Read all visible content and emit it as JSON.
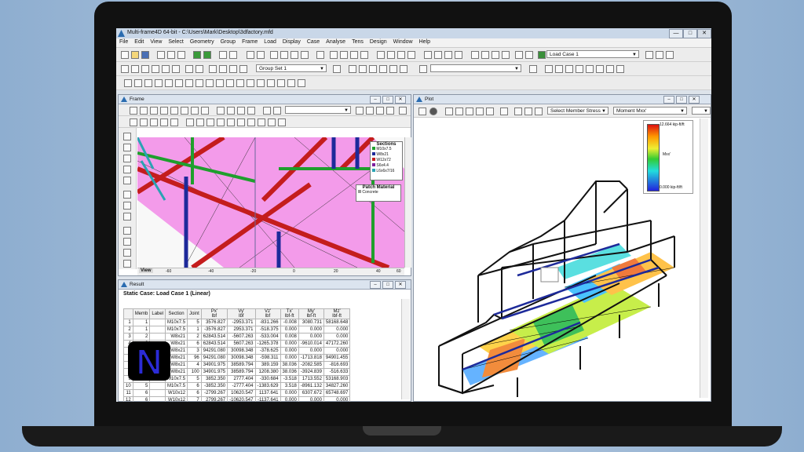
{
  "window": {
    "title": "Multi-frame4D 64-bit - C:\\Users\\Mark\\Desktop\\3dfactory.mfd",
    "btn_min": "—",
    "btn_max": "□",
    "btn_close": "✕"
  },
  "menu": [
    "File",
    "Edit",
    "View",
    "Select",
    "Geometry",
    "Group",
    "Frame",
    "Load",
    "Display",
    "Case",
    "Analyse",
    "Tens",
    "Design",
    "Window",
    "Help"
  ],
  "toolbar": {
    "load_case": "Load Case 1",
    "group_set": "Group Set 1"
  },
  "frame_panel": {
    "title": "Frame",
    "view_tab": "View",
    "ruler": [
      "-60",
      "-40",
      "-20",
      "0",
      "20",
      "40",
      "60"
    ],
    "legend_title": "Sections",
    "sections": [
      {
        "name": "M10x7.5",
        "color": "#1f9f2d"
      },
      {
        "name": "W8x21",
        "color": "#1d2a9a"
      },
      {
        "name": "W12x72",
        "color": "#c41d1d"
      },
      {
        "name": "S6x4.4",
        "color": "#7d1e9e"
      },
      {
        "name": "L6x6x7/16",
        "color": "#2aa3b3"
      }
    ],
    "patch_title": "Patch Material",
    "patch_item": "Concrete"
  },
  "plot_panel": {
    "title": "Plot",
    "select_stress": "Select Member Stress",
    "moment": "Moment Mxx'",
    "scale_max": "12.664 kip-ft/ft",
    "scale_label": "Mxx'",
    "scale_min": "0.000 kip-ft/ft"
  },
  "result_panel": {
    "title": "Result",
    "heading": "Static Case: Load Case 1 (Linear)",
    "cols": [
      "",
      "Memb",
      "Label",
      "Section",
      "Joint",
      "Px'\nlbf",
      "Vy'\nlbf",
      "Vz'\nlbf",
      "Tx'\nlbf-ft",
      "My'\nlbf-ft",
      "Mz'\nlbf-ft"
    ],
    "rows": [
      [
        "1",
        "1",
        "",
        "M10x7.5",
        "5",
        "3576.827",
        "-2953.371",
        "-831.266",
        "-0.008",
        "3080.731",
        "58168.648"
      ],
      [
        "2",
        "1",
        "",
        "M10x7.5",
        "1",
        "-3576.827",
        "2953.371",
        "-518.375",
        "0.000",
        "0.000",
        "0.000"
      ],
      [
        "3",
        "2",
        "",
        "W8x21",
        "2",
        "62843.514",
        "-5607.263",
        "-533.004",
        "0.008",
        "0.000",
        "0.000"
      ],
      [
        "4",
        "2",
        "",
        "W8x21",
        "6",
        "62843.514",
        "5607.263",
        "-1265.378",
        "0.000",
        "-9610.014",
        "47172.260"
      ],
      [
        "5",
        "3",
        "",
        "W8x21",
        "3",
        "94291.080",
        "30098.348",
        "-378.625",
        "0.000",
        "0.000",
        "0.000"
      ],
      [
        "6",
        "3",
        "",
        "W8x21",
        "96",
        "94291.080",
        "30098.348",
        "-598.311",
        "0.000",
        "-1713.818",
        "94901.455"
      ],
      [
        "7",
        "4",
        "",
        "W8x21",
        "4",
        "34901.975",
        "38589.794",
        "389.159",
        "38.036",
        "-2082.585",
        "-816.693"
      ],
      [
        "8",
        "4",
        "",
        "W8x21",
        "100",
        "34901.975",
        "38589.794",
        "1208.380",
        "38.036",
        "-3924.839",
        "-516.633"
      ],
      [
        "9",
        "5",
        "",
        "M10x7.5",
        "5",
        "3852.350",
        "2777.404",
        "-330.684",
        "-3.518",
        "1713.552",
        "53168.903"
      ],
      [
        "10",
        "5",
        "",
        "M10x7.5",
        "6",
        "-3852.350",
        "-2777.404",
        "-1383.629",
        "3.518",
        "-8961.132",
        "34827.260"
      ],
      [
        "11",
        "6",
        "",
        "W10x12",
        "6",
        "-2799.267",
        "10620.547",
        "1137.641",
        "0.000",
        "6307.672",
        "65748.697"
      ],
      [
        "12",
        "6",
        "",
        "W10x12",
        "7",
        "2799.267",
        "-10620.547",
        "-1137.641",
        "0.000",
        "0.000",
        "0.000"
      ]
    ]
  },
  "logo": {
    "letter": "N",
    "color": "#2b2bd6"
  }
}
